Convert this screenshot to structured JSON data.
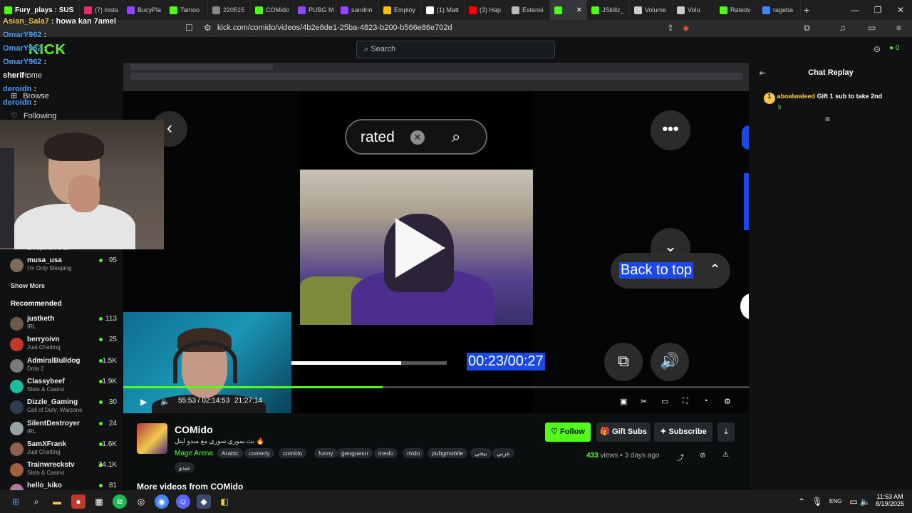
{
  "browser": {
    "tabs": [
      {
        "label": "Fury_plays : SUS",
        "color": "#53fc18"
      },
      {
        "label": "(7) Insta",
        "color": "#e1306c"
      },
      {
        "label": "BucyPla",
        "color": "#9146ff"
      },
      {
        "label": "Tamoo",
        "color": "#53fc18"
      },
      {
        "label": "220515",
        "color": "#888888"
      },
      {
        "label": "COMido",
        "color": "#53fc18"
      },
      {
        "label": "PUBG M",
        "color": "#9146ff"
      },
      {
        "label": "sandrin",
        "color": "#9146ff"
      },
      {
        "label": "Employ",
        "color": "#ffbc0d"
      },
      {
        "label": "(1) Matt",
        "color": "#ffffff"
      },
      {
        "label": "(3) Hap",
        "color": "#ff0000"
      },
      {
        "label": "Extensi",
        "color": "#bbbbbb"
      },
      {
        "label": "",
        "color": "#53fc18"
      },
      {
        "label": "JSkillz_",
        "color": "#53fc18"
      },
      {
        "label": "Volume",
        "color": "#cccccc"
      },
      {
        "label": "Volu",
        "color": "#cccccc"
      },
      {
        "label": "Ratedv",
        "color": "#53fc18"
      },
      {
        "label": "rageba",
        "color": "#4285f4"
      }
    ],
    "url": "kick.com/comido/videos/4b2e8de1-25ba-4823-b200-b566e86e702d",
    "window_controls": [
      "—",
      "❐",
      "✕"
    ]
  },
  "kick": {
    "logo": "KICK",
    "search_placeholder": "Search",
    "nav": [
      {
        "label": "Home"
      },
      {
        "label": "Browse"
      },
      {
        "label": "Following"
      }
    ],
    "show_more": "Show More",
    "recommended_title": "Recommended",
    "following_channels": [
      {
        "name": "EA Sports FC 25",
        "category": "",
        "viewers": ""
      },
      {
        "name": "musa_usa",
        "category": "I'm Only Sleeping",
        "viewers": "95"
      }
    ],
    "recommended": [
      {
        "name": "justketh",
        "category": "IRL",
        "viewers": "113",
        "color": "#6b5a4a"
      },
      {
        "name": "berryoivn",
        "category": "Just Chatting",
        "viewers": "25",
        "color": "#c0392b"
      },
      {
        "name": "AdmiralBulldog",
        "category": "Dota 2",
        "viewers": "1.5K",
        "color": "#7a7a7a"
      },
      {
        "name": "Classybeef",
        "category": "Slots & Casino",
        "viewers": "1.9K",
        "color": "#1abc9c"
      },
      {
        "name": "Dizzle_Gaming",
        "category": "Call of Duty: Warzone",
        "viewers": "30",
        "color": "#2c3e50"
      },
      {
        "name": "SilentDestroyer",
        "category": "IRL",
        "viewers": "24",
        "color": "#95a5a6"
      },
      {
        "name": "SamXFrank",
        "category": "Just Chatting",
        "viewers": "1.6K",
        "color": "#8e5e4e"
      },
      {
        "name": "Trainwreckstv",
        "category": "Slots & Casino",
        "viewers": "24.1K",
        "color": "#a55e3c"
      },
      {
        "name": "hello_kiko",
        "category": "",
        "viewers": "81",
        "color": "#b07aa1"
      }
    ]
  },
  "stream_overlay_chat": [
    {
      "user": "Asian_Sala7",
      "msg": ": howa kan 7amel"
    },
    {
      "user": "OmarY962",
      "msg": ":"
    },
    {
      "user": "OmarY962",
      "msg": ":"
    },
    {
      "user": "OmarY962",
      "msg": ":"
    },
    {
      "user": "sherif",
      "msg": ":"
    },
    {
      "user": "deroidn",
      "msg": ":"
    },
    {
      "user": "deroidn",
      "msg": ":"
    }
  ],
  "tiktok": {
    "search_text": "rated",
    "back_to_top": "Back to top",
    "time": "00:23/00:27",
    "progress": 0.71
  },
  "player": {
    "elapsed": "55:53",
    "duration": "02:14:53",
    "clock": "21:27:14",
    "progress": 0.415
  },
  "channel": {
    "name": "COMido",
    "title": "بث سوري سوري مع ميدو ليتل 🔥",
    "game": "Mage Arena",
    "tags": [
      "Arabic",
      "comedy",
      "comido",
      "funny",
      "geoguesrr",
      "medo",
      "mido",
      "pubgmobile",
      "بيجي",
      "عربي",
      "ميدو"
    ],
    "follow": "Follow",
    "gift_subs": "Gift Subs",
    "subscribe": "Subscribe",
    "views": "433",
    "views_label": "views",
    "age": "3 days ago",
    "more_videos": "More videos from COMido"
  },
  "chat": {
    "title": "Chat Replay",
    "messages": [
      {
        "badge": "1",
        "user": "aboalwaleed",
        "sub": "5",
        "text": "Gift 1 sub to take 2nd"
      }
    ]
  },
  "taskbar": {
    "lang": "ENG",
    "time": "11:53 AM",
    "date": "8/19/2025"
  }
}
